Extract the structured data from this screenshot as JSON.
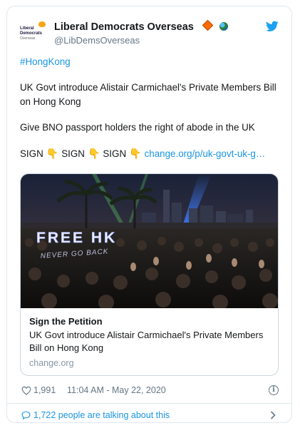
{
  "account": {
    "display_name": "Liberal Democrats Overseas",
    "handle": "@LibDemsOverseas",
    "avatar_line1": "Liberal",
    "avatar_line2": "Democrats",
    "avatar_line3": "Overseas"
  },
  "tweet": {
    "hashtag": "#HongKong",
    "paragraph1": "UK Govt introduce Alistair Carmichael's Private Members Bill on Hong Kong",
    "paragraph2": "Give BNO passport holders the right of abode in the UK",
    "sign_word": "SIGN",
    "pointing_emoji": "👇",
    "link": "change.org/p/uk-govt-uk-g…"
  },
  "media": {
    "photo_sign_text": "FREE HK",
    "photo_sign_text2": "NEVER GO BACK",
    "card_title": "Sign the Petition",
    "card_description": "UK Govt introduce Alistair Carmichael's Private Members Bill on Hong Kong",
    "card_domain": "change.org"
  },
  "meta": {
    "likes": "1,991",
    "timestamp": "11:04 AM - May 22, 2020",
    "info_glyph": "i"
  },
  "footer": {
    "talking_text": "1,722 people are talking about this"
  },
  "colors": {
    "link_blue": "#1b95e0",
    "muted_gray": "#657786",
    "border": "#e1e8ed"
  }
}
